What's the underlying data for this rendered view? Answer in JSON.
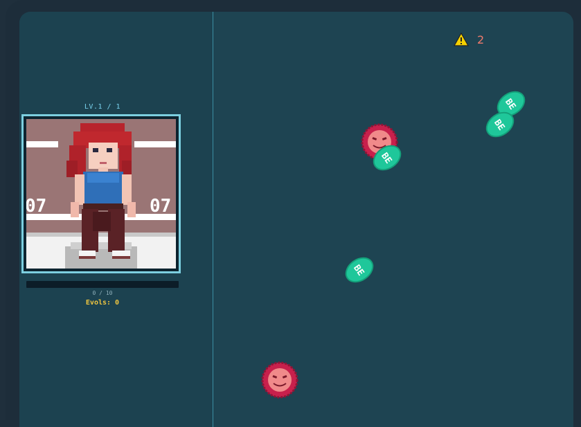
{
  "player": {
    "level_text": "LV.1 / 1",
    "xp_text": "0 / 10",
    "xp_progress": 0,
    "evols_text": "Evols: 0",
    "jersey_left": "07",
    "jersey_right": "07"
  },
  "hud": {
    "warning_icon": "warning-triangle-icon",
    "warning_count": "2"
  },
  "tokens": [
    {
      "label": "BE"
    },
    {
      "label": "BE"
    },
    {
      "label": "BE"
    },
    {
      "label": "BE"
    }
  ],
  "colors": {
    "token_green": "#1fc79a",
    "enemy_red": "#c8204c",
    "enemy_face": "#f08a8a",
    "warning_yellow": "#f6d200",
    "warning_count": "#f07a6c",
    "evols_yellow": "#f0c640"
  }
}
